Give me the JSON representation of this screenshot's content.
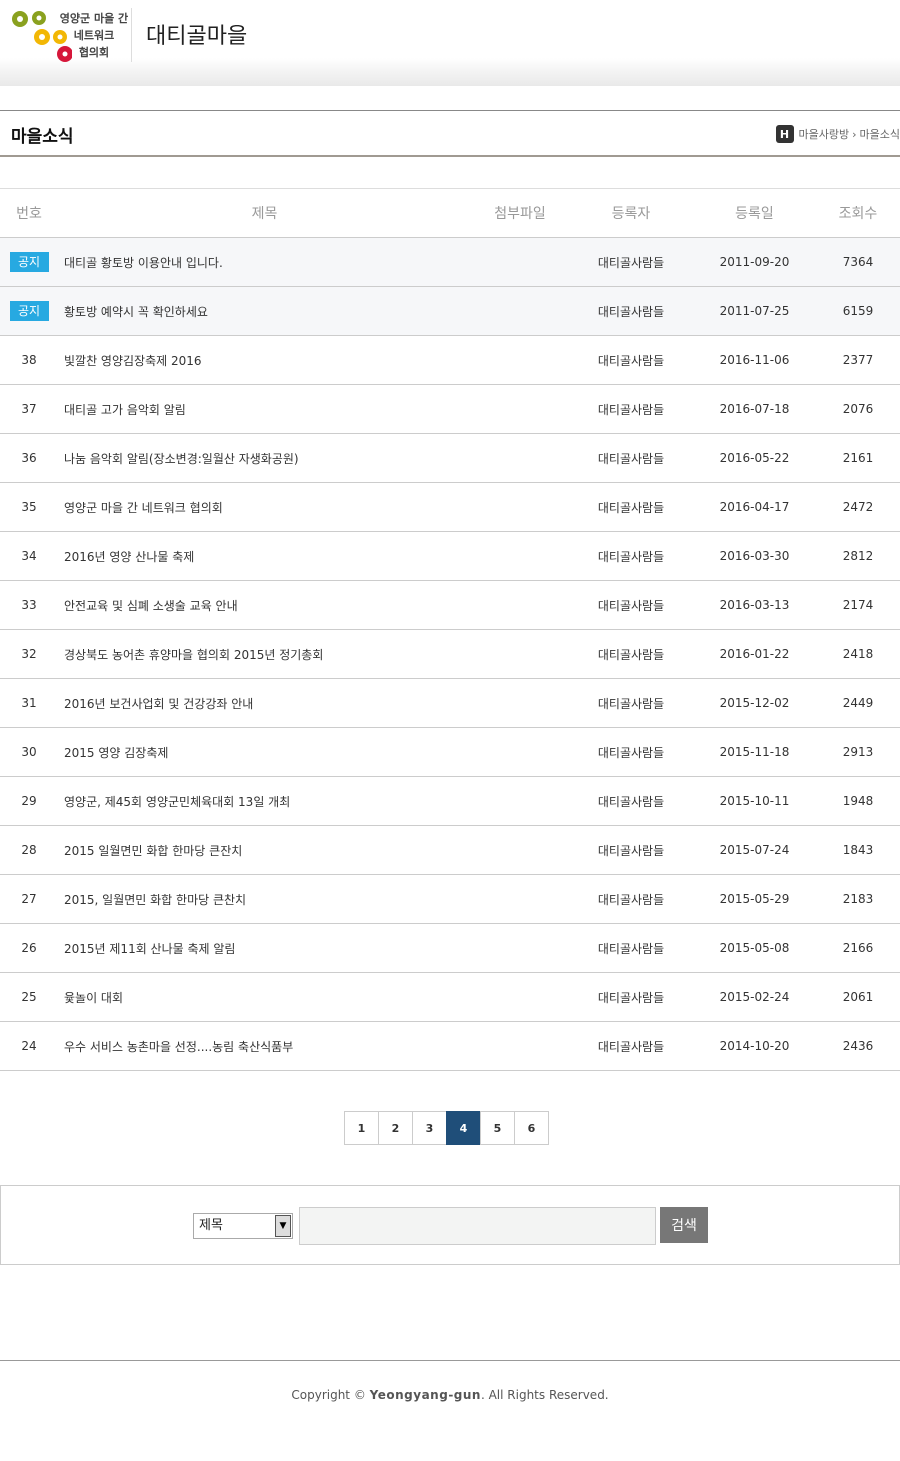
{
  "header": {
    "logo_line1": "영양군 마을 간",
    "logo_line2": "네트워크",
    "logo_line3": "협의회",
    "site_title": "대티골마을"
  },
  "title_bar": {
    "page_title": "마을소식",
    "home_icon_label": "H",
    "breadcrumb": [
      "마을사랑방",
      "마을소식"
    ]
  },
  "table": {
    "columns": [
      "번호",
      "제목",
      "첨부파일",
      "등록자",
      "등록일",
      "조회수"
    ],
    "notice_label": "공지",
    "notices": [
      {
        "subject": "대티골 황토방 이용안내 입니다.",
        "author": "대티골사람들",
        "date": "2011-09-20",
        "views": "7364"
      },
      {
        "subject": "황토방 예약시 꼭 확인하세요",
        "author": "대티골사람들",
        "date": "2011-07-25",
        "views": "6159"
      }
    ],
    "rows": [
      {
        "no": "38",
        "subject": "빛깔찬 영양김장축제 2016",
        "author": "대티골사람들",
        "date": "2016-11-06",
        "views": "2377"
      },
      {
        "no": "37",
        "subject": "대티골 고가 음악회 알림",
        "author": "대티골사람들",
        "date": "2016-07-18",
        "views": "2076"
      },
      {
        "no": "36",
        "subject": "나눔 음악회 알림(장소변경:일월산 자생화공원)",
        "author": "대티골사람들",
        "date": "2016-05-22",
        "views": "2161"
      },
      {
        "no": "35",
        "subject": "영양군 마을 간 네트워크 협의회",
        "author": "대티골사람들",
        "date": "2016-04-17",
        "views": "2472"
      },
      {
        "no": "34",
        "subject": "2016년 영양 산나물 축제",
        "author": "대티골사람들",
        "date": "2016-03-30",
        "views": "2812"
      },
      {
        "no": "33",
        "subject": "안전교육 및 심폐 소생술 교육 안내",
        "author": "대티골사람들",
        "date": "2016-03-13",
        "views": "2174"
      },
      {
        "no": "32",
        "subject": "경상북도 농어촌 휴양마을 협의회 2015년 정기총회",
        "author": "대티골사람들",
        "date": "2016-01-22",
        "views": "2418"
      },
      {
        "no": "31",
        "subject": "2016년 보건사업회 및 건강강좌 안내",
        "author": "대티골사람들",
        "date": "2015-12-02",
        "views": "2449"
      },
      {
        "no": "30",
        "subject": "2015 영양 김장축제",
        "author": "대티골사람들",
        "date": "2015-11-18",
        "views": "2913"
      },
      {
        "no": "29",
        "subject": "영양군, 제45회 영양군민체육대회 13일 개최",
        "author": "대티골사람들",
        "date": "2015-10-11",
        "views": "1948"
      },
      {
        "no": "28",
        "subject": "2015 일월면민 화합 한마당 큰잔치",
        "author": "대티골사람들",
        "date": "2015-07-24",
        "views": "1843"
      },
      {
        "no": "27",
        "subject": "2015, 일월면민 화합 한마당 큰찬치",
        "author": "대티골사람들",
        "date": "2015-05-29",
        "views": "2183"
      },
      {
        "no": "26",
        "subject": "2015년 제11회 산나물 축제 알림",
        "author": "대티골사람들",
        "date": "2015-05-08",
        "views": "2166"
      },
      {
        "no": "25",
        "subject": "윷놀이 대회",
        "author": "대티골사람들",
        "date": "2015-02-24",
        "views": "2061"
      },
      {
        "no": "24",
        "subject": "우수 서비스 농촌마을 선정....농림 축산식품부",
        "author": "대티골사람들",
        "date": "2014-10-20",
        "views": "2436"
      }
    ]
  },
  "pagination": {
    "pages": [
      "1",
      "2",
      "3",
      "4",
      "5",
      "6"
    ],
    "current": "4"
  },
  "search": {
    "select_value": "제목",
    "input_value": "",
    "button_label": "검색"
  },
  "footer": {
    "copyright_prefix": "Copyright ©",
    "copyright_owner": "Yeongyang-gun",
    "copyright_suffix": ". All Rights Reserved."
  },
  "colors": {
    "notice_badge": "#27a9e1",
    "active_page": "#1f4e79",
    "search_button": "#777777",
    "logo_olive": "#8aa11f",
    "logo_yellow": "#f2b705",
    "logo_red": "#d6173a"
  }
}
